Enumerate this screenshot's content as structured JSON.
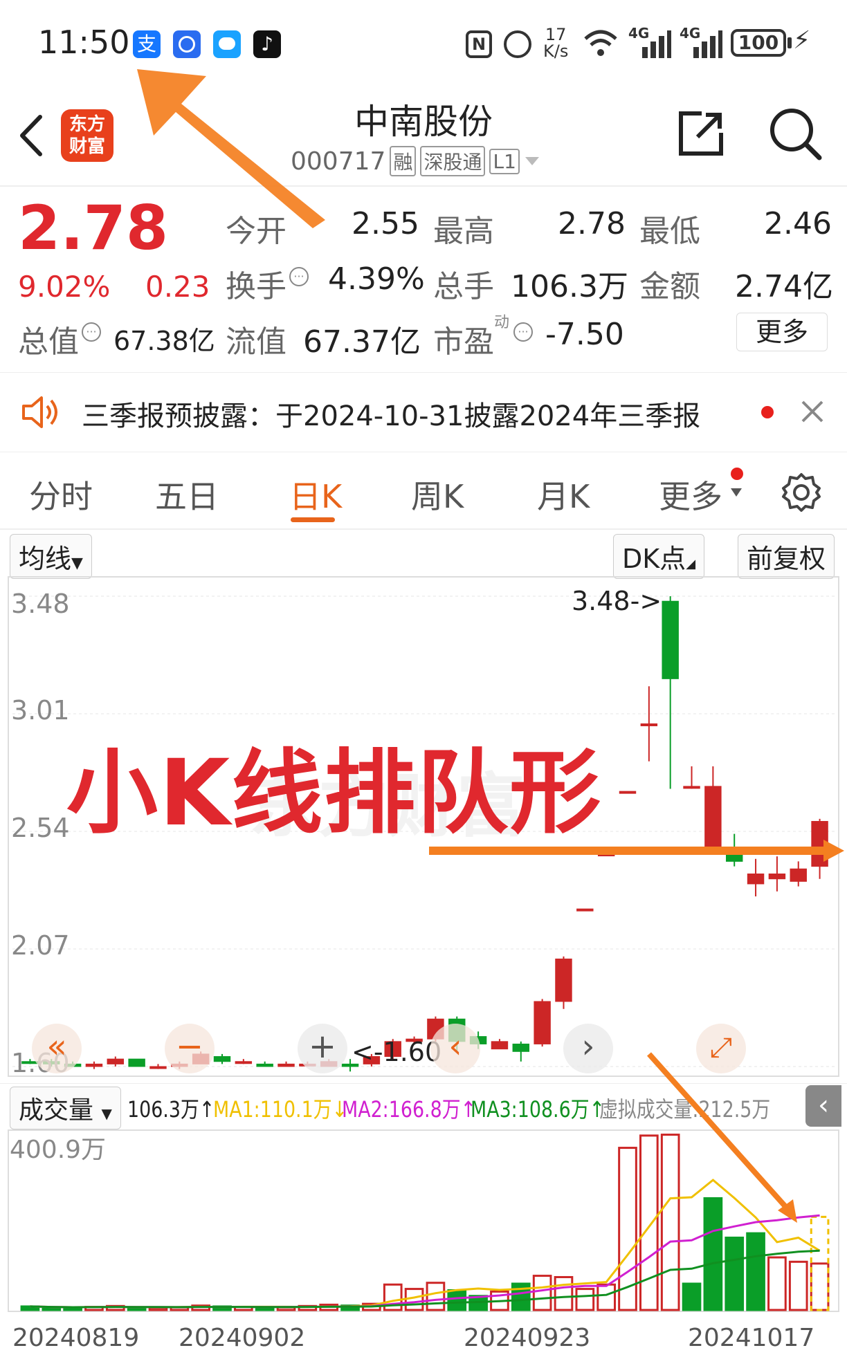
{
  "status_bar": {
    "time": "11:50",
    "app_icons": [
      "alipay-icon",
      "browser-icon",
      "message-icon",
      "tiktok-icon"
    ],
    "net_speed_top": "17",
    "net_speed_bottom": "K/s",
    "signal1_label": "4G",
    "signal2_label": "4G",
    "battery": "100"
  },
  "header": {
    "back_icon": "chevron-left-icon",
    "logo_line1": "东方",
    "logo_line2": "财富",
    "stock_name": "中南股份",
    "stock_code": "000717",
    "badges": [
      "融",
      "深股通",
      "L1"
    ],
    "share_icon": "share-icon",
    "search_icon": "search-icon"
  },
  "quote": {
    "price": "2.78",
    "change_pct": "9.02%",
    "change_amt": "0.23",
    "open_label": "今开",
    "open": "2.55",
    "high_label": "最高",
    "high": "2.78",
    "low_label": "最低",
    "low": "2.46",
    "turnover_label": "换手",
    "turnover": "4.39%",
    "volume_label": "总手",
    "volume": "106.3万",
    "amount_label": "金额",
    "amount": "2.74亿",
    "mktcap_label": "总值",
    "mktcap": "67.38亿",
    "float_label": "流值",
    "float": "67.37亿",
    "pe_label": "市盈",
    "pe_sup": "动",
    "pe": "-7.50",
    "more_button": "更多"
  },
  "notice": {
    "text": "三季报预披露：于2024-10-31披露2024年三季报"
  },
  "tabs": {
    "items": [
      "分时",
      "五日",
      "日K",
      "周K",
      "月K",
      "更多"
    ],
    "active": 2
  },
  "chart_toolbar": {
    "ma_button": "均线",
    "dk_button": "DK点",
    "adjust_button": "前复权"
  },
  "overlay": {
    "title": "小K线排队形",
    "watermark": "东方财富"
  },
  "volume_bar": {
    "label": "成交量",
    "vol": "106.3万↑",
    "ma1": "MA1:110.1万↓",
    "ma2": "MA2:166.8万↑",
    "ma3": "MA3:108.6万↑",
    "virtual": "虚拟成交量:212.5万",
    "ma1_color": "#f0c000",
    "ma2_color": "#d020d0",
    "ma3_color": "#109020"
  },
  "chart_data": [
    {
      "type": "candlestick",
      "ylim": [
        1.6,
        3.48
      ],
      "y_ticks": [
        "3.48",
        "3.01",
        "2.54",
        "2.07",
        "1.60"
      ],
      "annotations": [
        "3.48->",
        "<-1.60"
      ],
      "candles": [
        {
          "o": 1.62,
          "c": 1.62,
          "h": 1.63,
          "l": 1.61,
          "dir": "down"
        },
        {
          "o": 1.62,
          "c": 1.61,
          "h": 1.63,
          "l": 1.6,
          "dir": "down"
        },
        {
          "o": 1.61,
          "c": 1.6,
          "h": 1.62,
          "l": 1.6,
          "dir": "down"
        },
        {
          "o": 1.6,
          "c": 1.61,
          "h": 1.62,
          "l": 1.59,
          "dir": "up"
        },
        {
          "o": 1.61,
          "c": 1.63,
          "h": 1.64,
          "l": 1.6,
          "dir": "up"
        },
        {
          "o": 1.63,
          "c": 1.6,
          "h": 1.63,
          "l": 1.6,
          "dir": "down"
        },
        {
          "o": 1.6,
          "c": 1.6,
          "h": 1.61,
          "l": 1.59,
          "dir": "flat"
        },
        {
          "o": 1.6,
          "c": 1.61,
          "h": 1.62,
          "l": 1.59,
          "dir": "up"
        },
        {
          "o": 1.61,
          "c": 1.65,
          "h": 1.66,
          "l": 1.61,
          "dir": "up"
        },
        {
          "o": 1.64,
          "c": 1.62,
          "h": 1.65,
          "l": 1.61,
          "dir": "down"
        },
        {
          "o": 1.62,
          "c": 1.62,
          "h": 1.63,
          "l": 1.61,
          "dir": "flat"
        },
        {
          "o": 1.61,
          "c": 1.6,
          "h": 1.62,
          "l": 1.6,
          "dir": "down"
        },
        {
          "o": 1.6,
          "c": 1.61,
          "h": 1.62,
          "l": 1.6,
          "dir": "up"
        },
        {
          "o": 1.61,
          "c": 1.61,
          "h": 1.62,
          "l": 1.6,
          "dir": "up"
        },
        {
          "o": 1.6,
          "c": 1.62,
          "h": 1.63,
          "l": 1.6,
          "dir": "up"
        },
        {
          "o": 1.61,
          "c": 1.6,
          "h": 1.63,
          "l": 1.58,
          "dir": "down"
        },
        {
          "o": 1.61,
          "c": 1.64,
          "h": 1.65,
          "l": 1.6,
          "dir": "up"
        },
        {
          "o": 1.64,
          "c": 1.7,
          "h": 1.71,
          "l": 1.63,
          "dir": "up"
        },
        {
          "o": 1.7,
          "c": 1.71,
          "h": 1.72,
          "l": 1.69,
          "dir": "flat"
        },
        {
          "o": 1.71,
          "c": 1.79,
          "h": 1.8,
          "l": 1.7,
          "dir": "up"
        },
        {
          "o": 1.79,
          "c": 1.7,
          "h": 1.8,
          "l": 1.66,
          "dir": "down"
        },
        {
          "o": 1.72,
          "c": 1.69,
          "h": 1.74,
          "l": 1.67,
          "dir": "down"
        },
        {
          "o": 1.67,
          "c": 1.7,
          "h": 1.71,
          "l": 1.67,
          "dir": "up"
        },
        {
          "o": 1.69,
          "c": 1.66,
          "h": 1.7,
          "l": 1.62,
          "dir": "down"
        },
        {
          "o": 1.69,
          "c": 1.86,
          "h": 1.87,
          "l": 1.68,
          "dir": "up"
        },
        {
          "o": 1.86,
          "c": 2.03,
          "h": 2.04,
          "l": 1.83,
          "dir": "up"
        },
        {
          "o": 2.23,
          "c": 2.23,
          "h": 2.23,
          "l": 2.23,
          "dir": "flat"
        },
        {
          "o": 2.45,
          "c": 2.45,
          "h": 2.45,
          "l": 2.45,
          "dir": "flat"
        },
        {
          "o": 2.7,
          "c": 2.7,
          "h": 2.7,
          "l": 2.7,
          "dir": "flat"
        },
        {
          "o": 2.97,
          "c": 2.97,
          "h": 3.12,
          "l": 2.82,
          "dir": "up"
        },
        {
          "o": 3.15,
          "c": 3.46,
          "h": 3.48,
          "l": 2.71,
          "dir": "down"
        },
        {
          "o": 2.72,
          "c": 2.72,
          "h": 2.8,
          "l": 2.71,
          "dir": "flat"
        },
        {
          "o": 2.72,
          "c": 2.45,
          "h": 2.8,
          "l": 2.45,
          "dir": "up"
        },
        {
          "o": 2.45,
          "c": 2.42,
          "h": 2.53,
          "l": 2.4,
          "dir": "down"
        },
        {
          "o": 2.37,
          "c": 2.33,
          "h": 2.43,
          "l": 2.28,
          "dir": "up"
        },
        {
          "o": 2.37,
          "c": 2.35,
          "h": 2.44,
          "l": 2.3,
          "dir": "up"
        },
        {
          "o": 2.39,
          "c": 2.34,
          "h": 2.42,
          "l": 2.32,
          "dir": "up"
        },
        {
          "o": 2.4,
          "c": 2.58,
          "h": 2.59,
          "l": 2.35,
          "dir": "up"
        }
      ]
    },
    {
      "type": "bar",
      "title": "成交量",
      "ylabel_top": "400.9万",
      "ylim": [
        0,
        400.9
      ],
      "x_tick_labels": [
        "20240819",
        "20240902",
        "20240923",
        "20241017"
      ],
      "values": [
        8,
        6,
        5,
        7,
        9,
        6,
        5,
        6,
        10,
        8,
        7,
        5,
        6,
        9,
        12,
        10,
        14,
        58,
        48,
        62,
        45,
        32,
        42,
        60,
        78,
        75,
        48,
        58,
        370,
        398,
        400,
        60,
        255,
        165,
        175,
        120,
        110,
        106
      ],
      "dir": [
        "down",
        "down",
        "down",
        "up",
        "up",
        "down",
        "flat",
        "up",
        "up",
        "down",
        "flat",
        "down",
        "up",
        "up",
        "up",
        "down",
        "up",
        "up",
        "flat",
        "up",
        "down",
        "down",
        "up",
        "down",
        "up",
        "up",
        "up",
        "up",
        "up",
        "up",
        "up",
        "down",
        "down",
        "down",
        "down",
        "up",
        "up",
        "up"
      ]
    }
  ]
}
